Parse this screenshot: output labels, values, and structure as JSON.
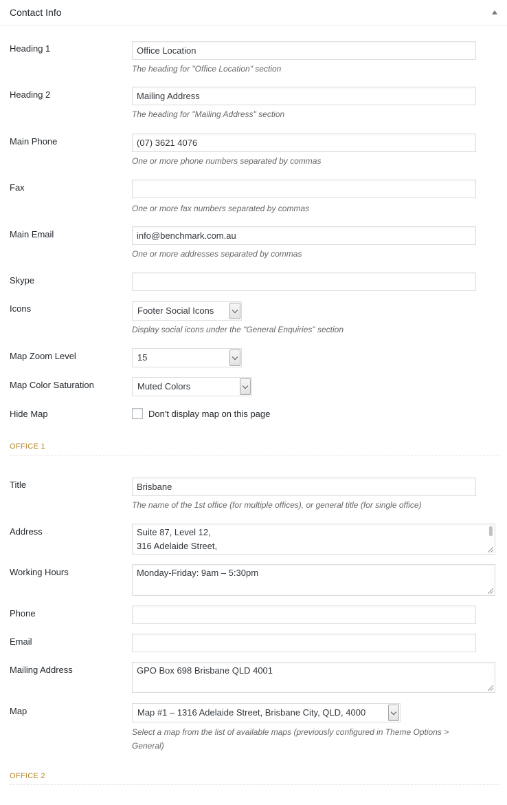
{
  "panel": {
    "title": "Contact Info"
  },
  "general": {
    "heading1": {
      "label": "Heading 1",
      "value": "Office Location",
      "desc": "The heading for \"Office Location\" section"
    },
    "heading2": {
      "label": "Heading 2",
      "value": "Mailing Address",
      "desc": "The heading for \"Mailing Address\" section"
    },
    "main_phone": {
      "label": "Main Phone",
      "value": "(07) 3621 4076",
      "desc": "One or more phone numbers separated by commas"
    },
    "fax": {
      "label": "Fax",
      "value": "",
      "desc": "One or more fax numbers separated by commas"
    },
    "main_email": {
      "label": "Main Email",
      "value": "info@benchmark.com.au",
      "desc": "One or more addresses separated by commas"
    },
    "skype": {
      "label": "Skype",
      "value": ""
    },
    "icons": {
      "label": "Icons",
      "value": "Footer Social Icons",
      "desc": "Display social icons under the \"General Enquiries\" section"
    },
    "map_zoom": {
      "label": "Map Zoom Level",
      "value": "15"
    },
    "map_saturation": {
      "label": "Map Color Saturation",
      "value": "Muted Colors"
    },
    "hide_map": {
      "label": "Hide Map",
      "checkbox_label": "Don't display map on this page"
    }
  },
  "office1": {
    "section_title": "OFFICE 1",
    "title": {
      "label": "Title",
      "value": "Brisbane",
      "desc": "The name of the 1st office (for multiple offices), or general title (for single office)"
    },
    "address": {
      "label": "Address",
      "line1": "Suite 87, Level 12,",
      "line2": "316 Adelaide Street,"
    },
    "working_hours": {
      "label": "Working Hours",
      "value": "Monday-Friday: 9am – 5:30pm"
    },
    "phone": {
      "label": "Phone",
      "value": ""
    },
    "email": {
      "label": "Email",
      "value": ""
    },
    "mailing_address": {
      "label": "Mailing Address",
      "value": "GPO Box 698 Brisbane QLD 4001"
    },
    "map": {
      "label": "Map",
      "value": "Map #1 – 1316 Adelaide Street, Brisbane City, QLD, 4000",
      "desc": "Select a map from the list of available maps (previously configured in Theme Options > General)"
    }
  },
  "office2": {
    "section_title": "OFFICE 2"
  }
}
